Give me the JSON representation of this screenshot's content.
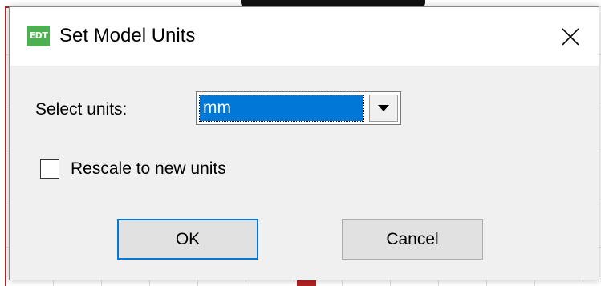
{
  "dialog": {
    "title": "Set Model Units",
    "app_icon_text": "EDT",
    "icons": {
      "app": "edt-app-icon",
      "close": "close-icon",
      "dropdown": "chevron-down-icon"
    }
  },
  "form": {
    "units_label": "Select units:",
    "units_selected": "mm",
    "rescale_label": "Rescale to new units",
    "rescale_checked": false
  },
  "buttons": {
    "ok_label": "OK",
    "cancel_label": "Cancel"
  },
  "colors": {
    "selection": "#0078d7",
    "app_icon": "#4caf50",
    "dialog_bg": "#f0f0f0"
  }
}
